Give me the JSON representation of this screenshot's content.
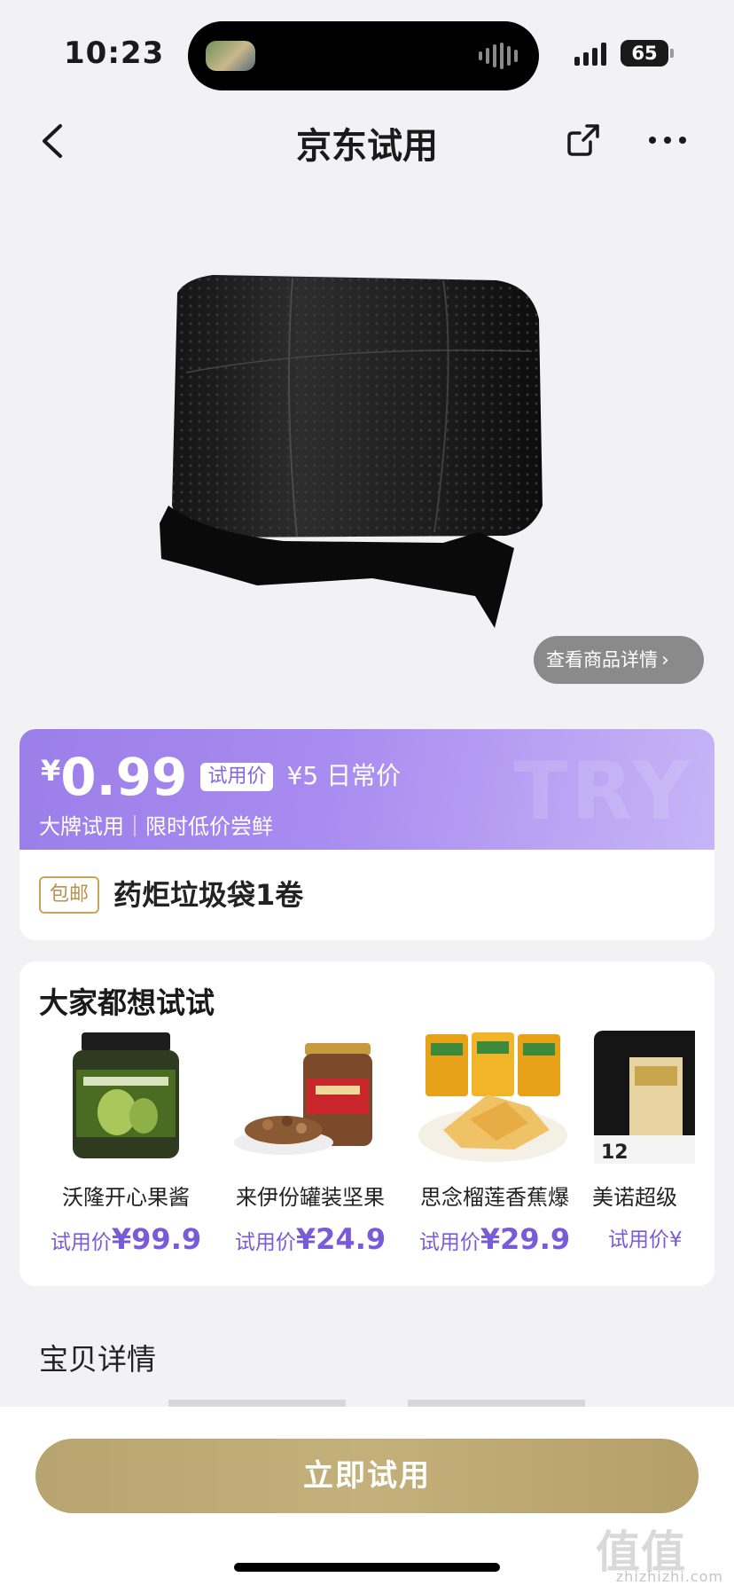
{
  "status_bar": {
    "time": "10:23",
    "battery": "65"
  },
  "nav": {
    "title": "京东试用",
    "icons": [
      "back-icon",
      "share-icon",
      "more-icon"
    ]
  },
  "product": {
    "detail_link": "查看商品详情",
    "price_symbol": "¥",
    "price": "0.99",
    "price_tag": "试用价",
    "regular_price": "¥5 日常价",
    "subtitle": "大牌试用｜限时低价尝鲜",
    "banner_watermark": "TRY",
    "shipping_badge": "包邮",
    "title": "药炬垃圾袋1卷"
  },
  "recommend": {
    "title": "大家都想试试",
    "items": [
      {
        "name": "沃隆开心果酱",
        "price_label": "试用价",
        "price": "¥99.9"
      },
      {
        "name": "来伊份罐装坚果",
        "price_label": "试用价",
        "price": "¥24.9"
      },
      {
        "name": "思念榴莲香蕉爆",
        "price_label": "试用价",
        "price": "¥29.9"
      },
      {
        "name": "美诺超级",
        "price_label": "试用价",
        "price": "¥"
      }
    ]
  },
  "details": {
    "heading": "宝贝详情"
  },
  "cta": {
    "label": "立即试用"
  },
  "watermark": {
    "logo": "值值值",
    "text": "zhizhizhi.com"
  },
  "colors": {
    "accent_purple": "#9b7ee8",
    "gold": "#c0ac74",
    "badge_gold": "#c9a35a"
  }
}
